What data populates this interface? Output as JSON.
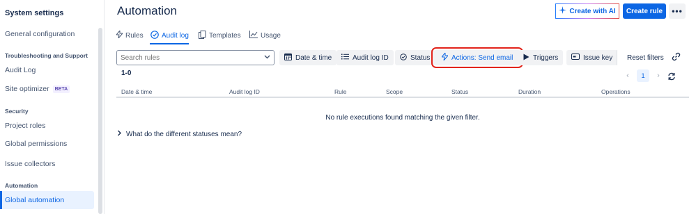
{
  "sidebar": {
    "title": "System settings",
    "items": [
      {
        "label": "General configuration"
      },
      {
        "label": "Audit Log"
      },
      {
        "label": "Site optimizer",
        "badge": "BETA"
      },
      {
        "label": "Project roles"
      },
      {
        "label": "Global permissions"
      },
      {
        "label": "Issue collectors"
      },
      {
        "label": "Global automation"
      }
    ],
    "sections": {
      "troubleshooting": "Troubleshooting and Support",
      "security": "Security",
      "automation": "Automation"
    }
  },
  "header": {
    "title": "Automation",
    "create_ai_label": "Create with AI",
    "create_rule_label": "Create rule",
    "more_label": "•••"
  },
  "tabs": [
    {
      "label": "Rules",
      "icon": "lightning-icon"
    },
    {
      "label": "Audit log",
      "icon": "check-circle-icon"
    },
    {
      "label": "Templates",
      "icon": "copy-icon"
    },
    {
      "label": "Usage",
      "icon": "chart-icon"
    }
  ],
  "filters": {
    "search_placeholder": "Search rules",
    "date_time": "Date & time",
    "audit_log_id": "Audit log ID",
    "status": "Status",
    "actions": "Actions: Send email",
    "triggers": "Triggers",
    "issue_key": "Issue key",
    "reset": "Reset filters"
  },
  "results": {
    "count": "1-0",
    "page": "1",
    "columns": [
      "Date & time",
      "Audit log ID",
      "Rule",
      "Scope",
      "Status",
      "Duration",
      "Operations"
    ],
    "empty_message": "No rule executions found matching the given filter.",
    "faq": "What do the different statuses mean?"
  },
  "colors": {
    "accent": "#0c66e4",
    "highlight_border": "#e2241b"
  }
}
